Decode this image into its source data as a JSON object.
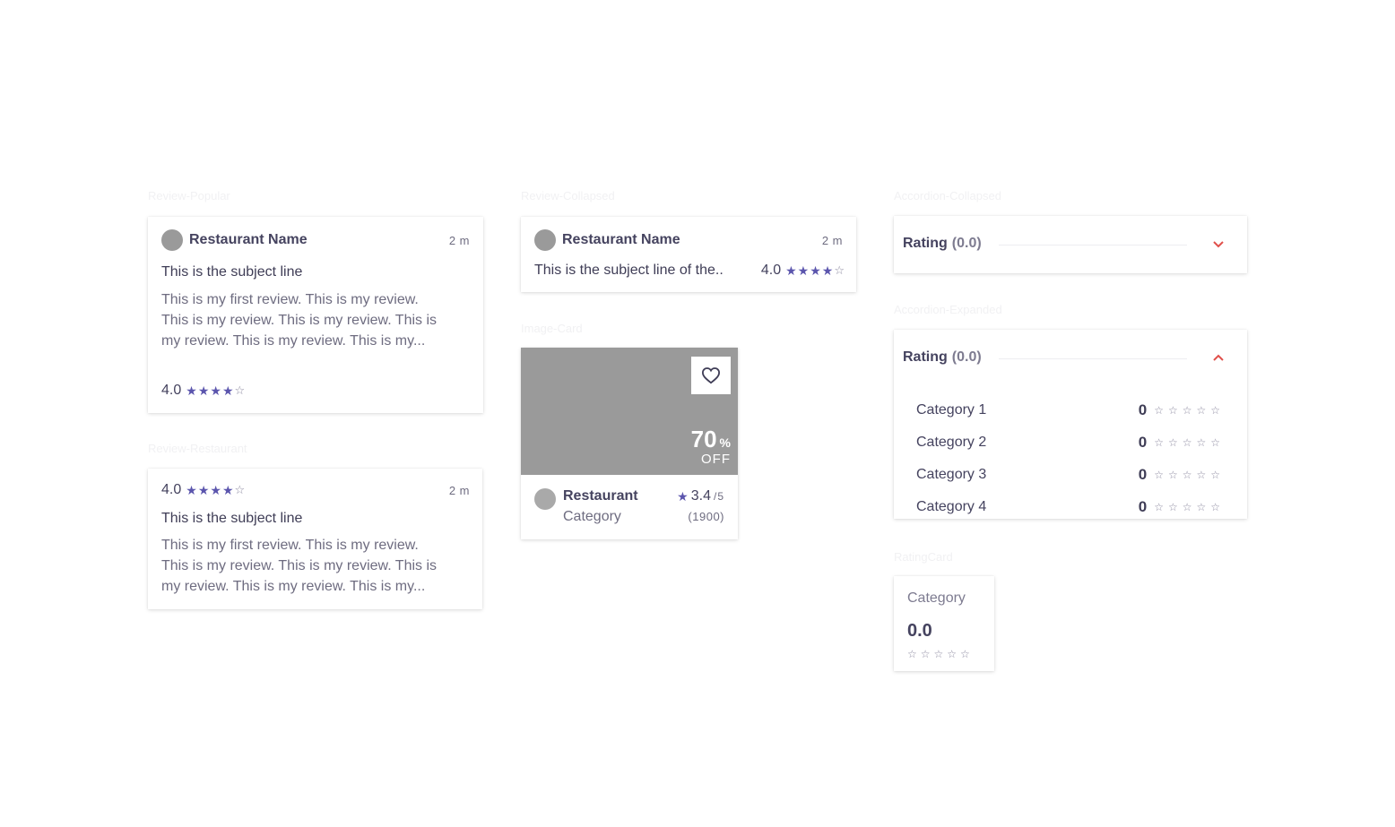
{
  "colors": {
    "accent": "#5b55ad",
    "chevron": "#e0504b",
    "placeholder": "#9a9a9a"
  },
  "labels": {
    "review_popular": "Review-Popular",
    "review_restaurant": "Review-Restaurant",
    "review_collapsed": "Review-Collapsed",
    "image_card": "Image-Card",
    "accordion_collapsed": "Accordion-Collapsed",
    "accordion_expanded": "Accordion-Expanded",
    "rating_card": "RatingCard"
  },
  "review_popular": {
    "restaurant_name": "Restaurant Name",
    "time": "2 m",
    "subject": "This is the subject line",
    "body_line1": "This is my first review. This is my review.",
    "body_line2": "This is my review. This is my review. This is",
    "body_line3": "my review. This is my review.  This is my...",
    "rating": "4.0",
    "stars": 4
  },
  "review_restaurant": {
    "rating": "4.0",
    "stars": 4,
    "time": "2 m",
    "subject": "This is the subject line",
    "body_line1": "This is my first review. This is my review.",
    "body_line2": "This is my review. This is my review. This is",
    "body_line3": "my review. This is my review.  This is my..."
  },
  "review_collapsed": {
    "restaurant_name": "Restaurant Name",
    "time": "2 m",
    "subject": "This is the subject line of the..",
    "rating": "4.0",
    "stars": 4
  },
  "image_card": {
    "discount": "70",
    "percent": "%",
    "off": "OFF",
    "heart_icon": "heart-icon",
    "restaurant": "Restaurant",
    "category": "Category",
    "rating": "3.4",
    "rating_max": "/5",
    "review_count": "(1900)"
  },
  "accordion_collapsed": {
    "title": "Rating",
    "count": "(0.0)",
    "icon": "chevron-down-icon"
  },
  "accordion_expanded": {
    "title": "Rating",
    "count": "(0.0)",
    "icon": "chevron-up-icon",
    "categories": [
      {
        "label": "Category 1",
        "score": "0"
      },
      {
        "label": "Category 2",
        "score": "0"
      },
      {
        "label": "Category 3",
        "score": "0"
      },
      {
        "label": "Category 4",
        "score": "0"
      }
    ]
  },
  "rating_card": {
    "category": "Category",
    "score": "0.0"
  }
}
